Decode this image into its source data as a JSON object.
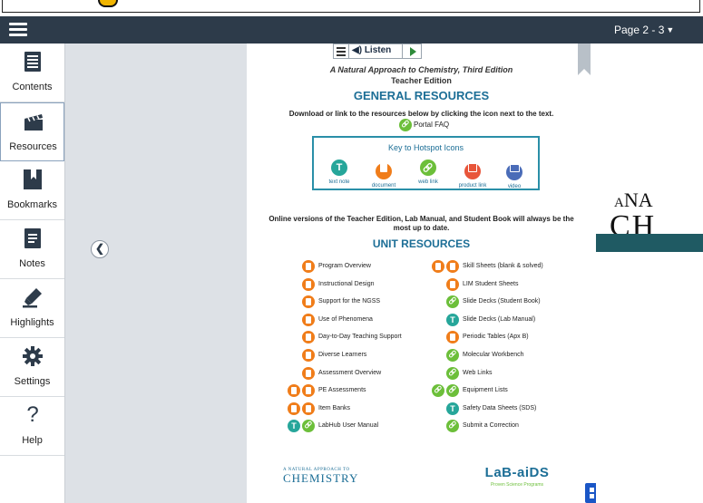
{
  "header": {
    "page_label": "Page 2 - 3"
  },
  "sidebar": {
    "items": [
      {
        "label": "Contents",
        "icon": "contents-icon"
      },
      {
        "label": "Resources",
        "icon": "clapperboard-icon"
      },
      {
        "label": "Bookmarks",
        "icon": "bookmark-icon"
      },
      {
        "label": "Notes",
        "icon": "notes-icon"
      },
      {
        "label": "Highlights",
        "icon": "highlighter-icon"
      },
      {
        "label": "Settings",
        "icon": "gear-icon"
      },
      {
        "label": "Help",
        "icon": "question-icon"
      }
    ]
  },
  "player": {
    "listen_label": "Listen"
  },
  "page": {
    "book_title": "A Natural Approach to Chemistry, Third Edition",
    "book_subtitle": "Teacher Edition",
    "general_heading": "GENERAL RESOURCES",
    "instructions": "Download or link to the resources below by clicking the icon next to the text.",
    "portal_faq": "Portal FAQ",
    "key": {
      "title": "Key to Hotspot Icons",
      "items": [
        {
          "label": "text note",
          "kind": "text"
        },
        {
          "label": "document",
          "kind": "doc"
        },
        {
          "label": "web link",
          "kind": "link"
        },
        {
          "label": "product link",
          "kind": "prod"
        },
        {
          "label": "video",
          "kind": "video"
        }
      ]
    },
    "online_note": "Online versions of the Teacher Edition, Lab Manual, and Student Book will always be the most up to date.",
    "unit_heading": "UNIT RESOURCES",
    "unit_left": [
      {
        "label": "Program Overview",
        "icons": [
          "doc"
        ]
      },
      {
        "label": "Instructional Design",
        "icons": [
          "doc"
        ]
      },
      {
        "label": "Support for the NGSS",
        "icons": [
          "doc"
        ]
      },
      {
        "label": "Use of Phenomena",
        "icons": [
          "doc"
        ]
      },
      {
        "label": "Day-to-Day Teaching Support",
        "icons": [
          "doc"
        ]
      },
      {
        "label": "Diverse Learners",
        "icons": [
          "doc"
        ]
      },
      {
        "label": "Assessment Overview",
        "icons": [
          "doc"
        ]
      },
      {
        "label": "PE Assessments",
        "icons": [
          "doc",
          "doc"
        ]
      },
      {
        "label": "Item Banks",
        "icons": [
          "doc",
          "doc"
        ]
      },
      {
        "label": "LabHub User Manual",
        "icons": [
          "text",
          "link"
        ]
      }
    ],
    "unit_right": [
      {
        "label": "Skill Sheets (blank & solved)",
        "icons": [
          "doc",
          "doc"
        ]
      },
      {
        "label": "LIM Student Sheets",
        "icons": [
          "doc"
        ]
      },
      {
        "label": "Slide Decks (Student Book)",
        "icons": [
          "link"
        ]
      },
      {
        "label": "Slide Decks (Lab Manual)",
        "icons": [
          "text"
        ]
      },
      {
        "label": "Periodic Tables (Apx B)",
        "icons": [
          "doc"
        ]
      },
      {
        "label": "Molecular Workbench",
        "icons": [
          "link"
        ]
      },
      {
        "label": "Web Links",
        "icons": [
          "link"
        ]
      },
      {
        "label": "Equipment Lists",
        "icons": [
          "link",
          "link"
        ]
      },
      {
        "label": "Safety Data Sheets (SDS)",
        "icons": [
          "text"
        ]
      },
      {
        "label": "Submit a Correction",
        "icons": [
          "link"
        ]
      }
    ],
    "logo_left_small": "A NATURAL APPROACH TO",
    "logo_left_big": "CHEMISTRY",
    "logo_right_big": "LaB-aiDS",
    "logo_right_small": "Proven Science Programs"
  },
  "cover": {
    "line1_prefix": "A",
    "line1": "NA",
    "line2": "CH"
  },
  "colors": {
    "header": "#2d3b4a",
    "heading_blue": "#1c6e96",
    "doc_orange": "#f07d1a",
    "link_green": "#6cbf3a",
    "text_teal": "#26a69a",
    "product_red": "#e8553a",
    "video_blue": "#4a6cb8"
  }
}
